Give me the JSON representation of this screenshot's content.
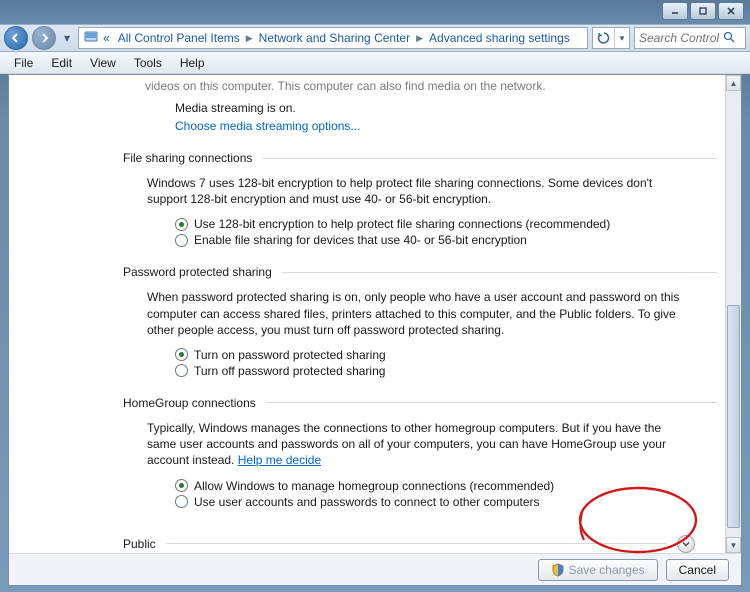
{
  "window": {
    "minimize": "–",
    "maximize": "□",
    "close": "✕"
  },
  "breadcrumb": {
    "back_chevrons": "«",
    "items": [
      "All Control Panel Items",
      "Network and Sharing Center",
      "Advanced sharing settings"
    ]
  },
  "search": {
    "placeholder": "Search Control P..."
  },
  "menubar": [
    "File",
    "Edit",
    "View",
    "Tools",
    "Help"
  ],
  "media": {
    "cutoff_line": "videos on this computer. This computer can also find media on the network.",
    "status": "Media streaming is on.",
    "link": "Choose media streaming options..."
  },
  "sections": {
    "file_sharing": {
      "title": "File sharing connections",
      "desc": "Windows 7 uses 128-bit encryption to help protect file sharing connections. Some devices don't support 128-bit encryption and must use 40- or 56-bit encryption.",
      "opt1": "Use 128-bit encryption to help protect file sharing connections (recommended)",
      "opt2": "Enable file sharing for devices that use 40- or 56-bit encryption"
    },
    "password": {
      "title": "Password protected sharing",
      "desc": "When password protected sharing is on, only people who have a user account and password on this computer can access shared files, printers attached to this computer, and the Public folders. To give other people access, you must turn off password protected sharing.",
      "opt1": "Turn on password protected sharing",
      "opt2": "Turn off password protected sharing"
    },
    "homegroup": {
      "title": "HomeGroup connections",
      "desc_a": "Typically, Windows manages the connections to other homegroup computers. But if you have the same user accounts and passwords on all of your computers, you can have HomeGroup use your account instead. ",
      "help_link": "Help me decide",
      "opt1": "Allow Windows to manage homegroup connections (recommended)",
      "opt2": "Use user accounts and passwords to connect to other computers"
    }
  },
  "profile": {
    "public": "Public"
  },
  "footer": {
    "save": "Save changes",
    "cancel": "Cancel"
  }
}
